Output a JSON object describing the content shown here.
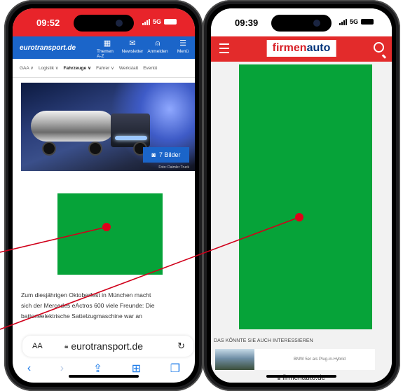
{
  "phone1": {
    "time": "09:52",
    "network": "5G",
    "logo": "eurotransport.de",
    "nav": [
      {
        "icon": "grid-icon",
        "glyph": "▦",
        "label": "Themen A-Z"
      },
      {
        "icon": "mail-icon",
        "glyph": "✉",
        "label": "Newsletter"
      },
      {
        "icon": "user-icon",
        "glyph": "⍝",
        "label": "Anmelden"
      },
      {
        "icon": "menu-icon",
        "glyph": "☰",
        "label": "Menü"
      }
    ],
    "categories": [
      {
        "label": "GAA ∨",
        "active": false
      },
      {
        "label": "Logistik ∨",
        "active": false
      },
      {
        "label": "Fahrzeuge ∨",
        "active": true
      },
      {
        "label": "Fahrer ∨",
        "active": false
      },
      {
        "label": "Werkstatt",
        "active": false
      },
      {
        "label": "Eventü",
        "active": false
      }
    ],
    "photos_badge": "7 Bilder",
    "photo_credit": "Foto: Daimler Truck",
    "article_lines": [
      "Zum diesjährigen Oktoberfest in München macht",
      "sich der Mercedes eActros 600 viele Freunde: Die",
      "batterieelektrische Sattelzugmaschine war an"
    ],
    "url": "eurotransport.de",
    "aa_label": "AA",
    "toolbar_icons": [
      "back-icon",
      "forward-icon",
      "share-icon",
      "bookmarks-icon",
      "tabs-icon"
    ]
  },
  "phone2": {
    "time": "09:39",
    "network": "5G",
    "logo_part1": "firmen",
    "logo_part2": "auto",
    "interest_heading": "DAS KÖNNTE SIE AUCH INTERESSIEREN",
    "rec_title": "BMW 5er als Plug-in-Hybrid",
    "url": "firmenauto.de"
  },
  "colors": {
    "et_red": "#e8242a",
    "et_blue": "#1b65c9",
    "fa_red": "#e32b2b",
    "ad_green": "#06a339",
    "marker": "#e0001a"
  }
}
